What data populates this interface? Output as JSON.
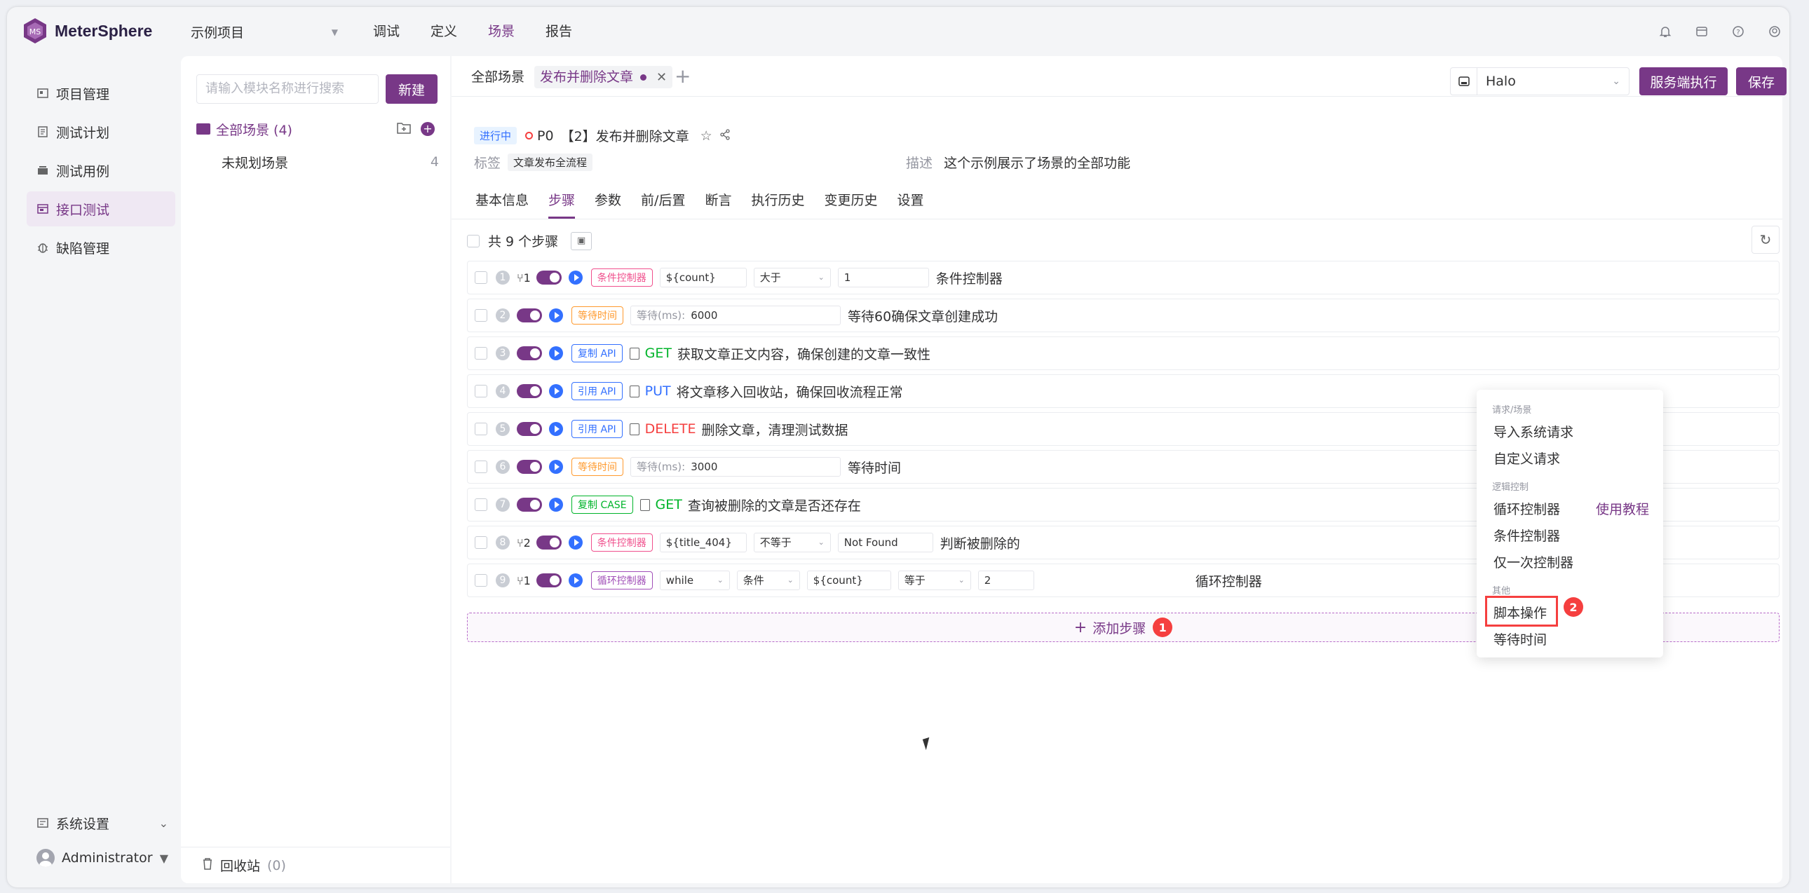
{
  "app": {
    "name": "MeterSphere",
    "project": "示例项目"
  },
  "topnav": [
    "调试",
    "定义",
    "场景",
    "报告"
  ],
  "topnav_active": 2,
  "sidebar": {
    "items": [
      "项目管理",
      "测试计划",
      "测试用例",
      "接口测试",
      "缺陷管理"
    ],
    "active": 3,
    "settings": "系统设置",
    "user": "Administrator"
  },
  "tree": {
    "search_placeholder": "请输入模块名称进行搜索",
    "new_button": "新建",
    "root_label": "全部场景 (4)",
    "child_label": "未规划场景",
    "child_count": "4",
    "recycle_label": "回收站",
    "recycle_count": "(0)"
  },
  "tabs": {
    "all": "全部场景",
    "current": "发布并删除文章"
  },
  "env": {
    "value": "Halo"
  },
  "buttons": {
    "run": "服务端执行",
    "save": "保存"
  },
  "scenario": {
    "status": "进行中",
    "priority": "P0",
    "title": "【2】发布并删除文章",
    "tag_label": "标签",
    "tag": "文章发布全流程",
    "desc_label": "描述",
    "desc": "这个示例展示了场景的全部功能"
  },
  "sub_tabs": [
    "基本信息",
    "步骤",
    "参数",
    "前/后置",
    "断言",
    "执行历史",
    "变更历史",
    "设置"
  ],
  "sub_tab_active": 1,
  "steps_total": "共 9 个步骤",
  "steps": [
    {
      "num": "1",
      "branch": "1",
      "tag": "条件控制器",
      "kind": "cond",
      "f1": "${count}",
      "op": "大于",
      "f2": "1",
      "name": "条件控制器"
    },
    {
      "num": "2",
      "tag": "等待时间",
      "kind": "wait",
      "wait_label": "等待(ms):",
      "wait": "6000",
      "name": "等待60确保文章创建成功"
    },
    {
      "num": "3",
      "tag": "复制 API",
      "kind": "api",
      "method": "GET",
      "name": "获取文章正文内容，确保创建的文章一致性"
    },
    {
      "num": "4",
      "tag": "引用 API",
      "kind": "api",
      "method": "PUT",
      "name": "将文章移入回收站，确保回收流程正常"
    },
    {
      "num": "5",
      "tag": "引用 API",
      "kind": "api",
      "method": "DELETE",
      "name": "删除文章，清理测试数据"
    },
    {
      "num": "6",
      "tag": "等待时间",
      "kind": "wait",
      "wait_label": "等待(ms):",
      "wait": "3000",
      "name": "等待时间"
    },
    {
      "num": "7",
      "tag": "复制 CASE",
      "kind": "case",
      "method": "GET",
      "name": "查询被删除的文章是否还存在"
    },
    {
      "num": "8",
      "branch": "2",
      "tag": "条件控制器",
      "kind": "cond",
      "f1": "${title_404}",
      "op": "不等于",
      "f2": "Not Found",
      "name": "判断被删除的"
    },
    {
      "num": "9",
      "branch": "1",
      "tag": "循环控制器",
      "kind": "loop",
      "loop_type": "while",
      "cond": "条件",
      "f1": "${count}",
      "op": "等于",
      "f2": "2",
      "name": "循环控制器"
    }
  ],
  "add_step": {
    "label": "添加步骤",
    "badge": "1"
  },
  "menu": {
    "group1": "请求/场景",
    "import": "导入系统请求",
    "custom": "自定义请求",
    "group2": "逻辑控制",
    "loop": "循环控制器",
    "tutorial": "使用教程",
    "cond": "条件控制器",
    "once": "仅一次控制器",
    "group3": "其他",
    "script": "脚本操作",
    "badge": "2",
    "wait": "等待时间"
  },
  "colors": {
    "accent": "#783887",
    "blue": "#3370ff",
    "red": "#f53f3f",
    "green": "#00b42a"
  }
}
